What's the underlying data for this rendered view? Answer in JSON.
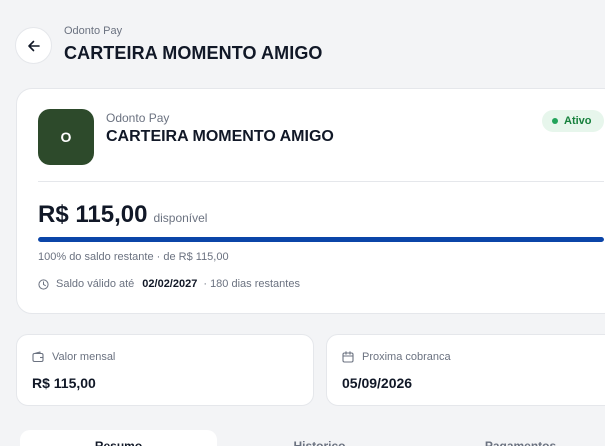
{
  "header": {
    "subtitle": "Odonto Pay",
    "title": "CARTEIRA MOMENTO AMIGO"
  },
  "wallet": {
    "avatar_letter": "O",
    "provider": "Odonto Pay",
    "name": "CARTEIRA MOMENTO AMIGO",
    "status": "Ativo",
    "balance": "R$ 115,00",
    "balance_suffix": "disponível",
    "progress_percent": 100,
    "progress_text": "100% do saldo restante · de R$ 115,00",
    "validity_label": "Saldo válido até",
    "validity_date": "02/02/2027",
    "validity_remaining": "· 180 dias restantes"
  },
  "info": {
    "monthly_label": "Valor mensal",
    "monthly_value": "R$ 115,00",
    "next_charge_label": "Proxima cobranca",
    "next_charge_value": "05/09/2026"
  },
  "tabs": [
    {
      "label": "Resumo"
    },
    {
      "label": "Historico"
    },
    {
      "label": "Pagamentos"
    }
  ],
  "colors": {
    "avatar": "#2d4a2b",
    "progress": "#0b45a8",
    "status_bg": "#e7f6ec",
    "status_text": "#16803c"
  }
}
